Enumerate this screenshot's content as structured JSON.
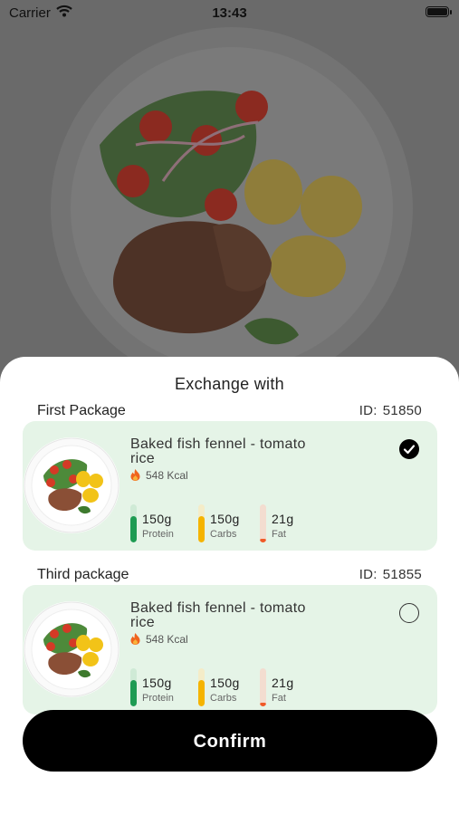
{
  "status_bar": {
    "carrier": "Carrier",
    "time": "13:43"
  },
  "sheet": {
    "title": "Exchange with",
    "confirm_label": "Confirm"
  },
  "packages": [
    {
      "name": "First Package",
      "id_prefix": "ID:",
      "id": "51850",
      "meal": {
        "name": "Baked fish fennel - tomato rice",
        "kcal": "548 Kcal"
      },
      "selected": true,
      "nutrients": [
        {
          "value": "150g",
          "label": "Protein",
          "color": "#1e9b53",
          "track": "#cfead6",
          "fill": 0.7
        },
        {
          "value": "150g",
          "label": "Carbs",
          "color": "#f5b400",
          "track": "#f4ecc8",
          "fill": 0.7
        },
        {
          "value": "21g",
          "label": "Fat",
          "color": "#f05a28",
          "track": "#f3ddd0",
          "fill": 0.1
        }
      ]
    },
    {
      "name": "Third package",
      "id_prefix": "ID:",
      "id": "51855",
      "meal": {
        "name": "Baked fish fennel - tomato rice",
        "kcal": "548 Kcal"
      },
      "selected": false,
      "nutrients": [
        {
          "value": "150g",
          "label": "Protein",
          "color": "#1e9b53",
          "track": "#cfead6",
          "fill": 0.7
        },
        {
          "value": "150g",
          "label": "Carbs",
          "color": "#f5b400",
          "track": "#f4ecc8",
          "fill": 0.7
        },
        {
          "value": "21g",
          "label": "Fat",
          "color": "#f05a28",
          "track": "#f3ddd0",
          "fill": 0.1
        }
      ]
    }
  ],
  "colors": {
    "card_bg": "#e5f4e7",
    "button_bg": "#000000",
    "overlay": "#6b6b6b"
  },
  "icons": {
    "flame": "flame-icon",
    "check": "checkmark-icon",
    "wifi": "wifi-icon",
    "battery": "battery-icon"
  }
}
